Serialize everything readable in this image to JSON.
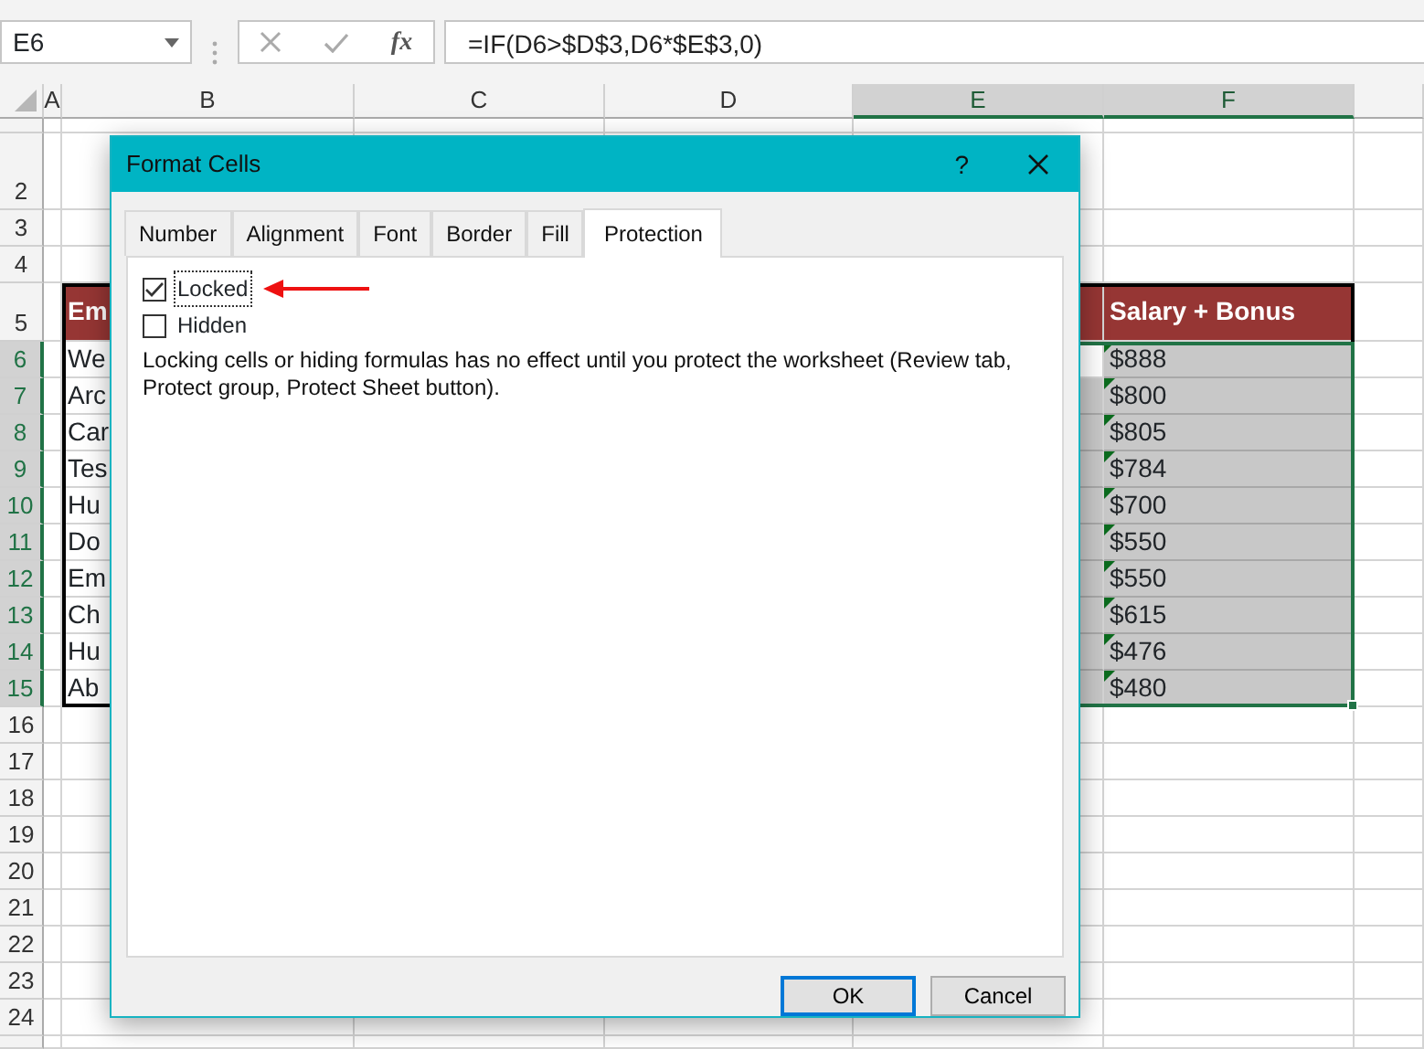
{
  "name_box": {
    "value": "E6"
  },
  "formula_bar": {
    "fx": "fx",
    "formula": "=IF(D6>$D$3,D6*$E$3,0)"
  },
  "columns": [
    {
      "label": "A",
      "selected": false
    },
    {
      "label": "B",
      "selected": false
    },
    {
      "label": "C",
      "selected": false
    },
    {
      "label": "D",
      "selected": false
    },
    {
      "label": "E",
      "selected": true
    },
    {
      "label": "F",
      "selected": true
    }
  ],
  "rows": [
    {
      "label": "2",
      "selected": false
    },
    {
      "label": "3",
      "selected": false
    },
    {
      "label": "4",
      "selected": false
    },
    {
      "label": "5",
      "selected": false
    },
    {
      "label": "6",
      "selected": true
    },
    {
      "label": "7",
      "selected": true
    },
    {
      "label": "8",
      "selected": true
    },
    {
      "label": "9",
      "selected": true
    },
    {
      "label": "10",
      "selected": true
    },
    {
      "label": "11",
      "selected": true
    },
    {
      "label": "12",
      "selected": true
    },
    {
      "label": "13",
      "selected": true
    },
    {
      "label": "14",
      "selected": true
    },
    {
      "label": "15",
      "selected": true
    },
    {
      "label": "16",
      "selected": false
    },
    {
      "label": "17",
      "selected": false
    },
    {
      "label": "18",
      "selected": false
    },
    {
      "label": "19",
      "selected": false
    },
    {
      "label": "20",
      "selected": false
    },
    {
      "label": "21",
      "selected": false
    },
    {
      "label": "22",
      "selected": false
    },
    {
      "label": "23",
      "selected": false
    },
    {
      "label": "24",
      "selected": false
    }
  ],
  "table": {
    "header": {
      "col_b": "Em",
      "col_f": "Salary + Bonus"
    },
    "rows": [
      {
        "col_b": "We",
        "col_f": "$888",
        "error_flag": true
      },
      {
        "col_b": "Arc",
        "col_f": "$800",
        "error_flag": true
      },
      {
        "col_b": "Car",
        "col_f": "$805",
        "error_flag": true
      },
      {
        "col_b": "Tes",
        "col_f": "$784",
        "error_flag": true
      },
      {
        "col_b": "Hu",
        "col_f": "$700",
        "error_flag": true
      },
      {
        "col_b": "Do",
        "col_f": "$550",
        "error_flag": true
      },
      {
        "col_b": "Em",
        "col_f": "$550",
        "error_flag": true
      },
      {
        "col_b": "Ch",
        "col_f": "$615",
        "error_flag": true
      },
      {
        "col_b": "Hu",
        "col_f": "$476",
        "error_flag": true
      },
      {
        "col_b": "Ab",
        "col_f": "$480",
        "error_flag": true
      }
    ]
  },
  "dialog": {
    "title": "Format Cells",
    "help": "?",
    "tabs": [
      {
        "label": "Number",
        "selected": false
      },
      {
        "label": "Alignment",
        "selected": false
      },
      {
        "label": "Font",
        "selected": false
      },
      {
        "label": "Border",
        "selected": false
      },
      {
        "label": "Fill",
        "selected": false
      },
      {
        "label": "Protection",
        "selected": true
      }
    ],
    "options": [
      {
        "label": "Locked",
        "checked": true,
        "focused": true
      },
      {
        "label": "Hidden",
        "checked": false,
        "focused": false
      }
    ],
    "note": "Locking cells or hiding formulas has no effect until you protect the worksheet (Review tab, Protect group, Protect Sheet button).",
    "buttons": [
      {
        "label": "OK",
        "default": true
      },
      {
        "label": "Cancel",
        "default": false
      }
    ]
  },
  "annotation": {
    "kind": "arrow",
    "color": "#ee1111"
  }
}
